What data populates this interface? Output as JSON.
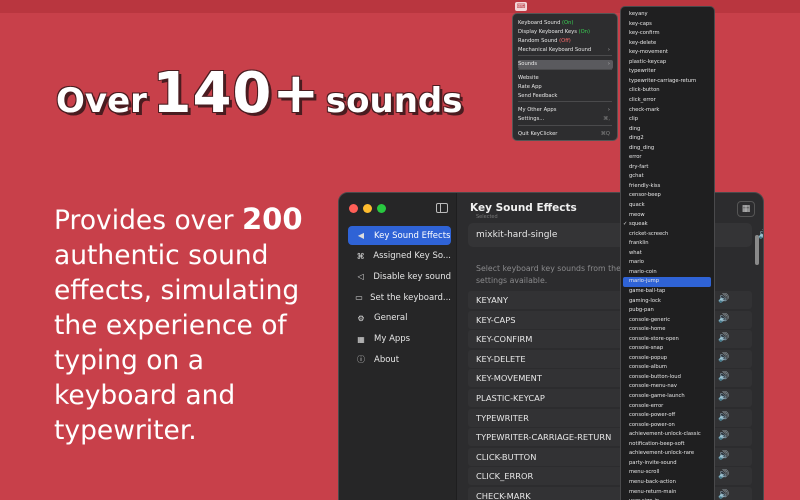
{
  "headline": {
    "prefix": "Over",
    "number": "140+",
    "suffix": "sounds"
  },
  "blurb": {
    "lines": [
      {
        "text": "Provides over ",
        "num": "200"
      },
      {
        "text": "authentic sound"
      },
      {
        "text": "effects, simulating"
      },
      {
        "text": "the experience of"
      },
      {
        "text": "typing on a"
      },
      {
        "text": "keyboard and"
      },
      {
        "text": "typewriter."
      }
    ]
  },
  "menubar": {
    "app_icon": "keyclicker-icon"
  },
  "menu": {
    "items": [
      {
        "label": "Keyboard Sound",
        "state": "(On)",
        "state_kind": "on",
        "icon": "speaker-icon"
      },
      {
        "label": "Display Keyboard Keys",
        "state": "(On)",
        "state_kind": "on",
        "icon": "display-icon"
      },
      {
        "label": "Random Sound",
        "state": "(Off)",
        "state_kind": "off",
        "icon": "shuffle-icon"
      },
      {
        "label": "Mechanical Keyboard Sound",
        "state": "",
        "arrow": "›",
        "icon": "keyboard-icon"
      },
      {
        "label": "Sounds",
        "state": "",
        "arrow": "›",
        "icon": "speaker-icon",
        "highlighted": true
      },
      {
        "label": "Website"
      },
      {
        "label": "Rate App"
      },
      {
        "label": "Send Feedback"
      },
      {
        "label": "My Other Apps",
        "arrow": "›"
      },
      {
        "label": "Settings...",
        "shortcut": "⌘,"
      },
      {
        "label": "Quit KeyClicker",
        "shortcut": "⌘Q"
      }
    ]
  },
  "sounds": {
    "items": [
      "keyany",
      "key-caps",
      "key-confirm",
      "key-delete",
      "key-movement",
      "plastic-keycap",
      "typewriter",
      "typewriter-carriage-return",
      "click-button",
      "click_error",
      "check-mark",
      "clip",
      "ding",
      "ding2",
      "ding_ding",
      "error",
      "dry-fart",
      "gchat",
      "friendly-kiss",
      "censor-beep",
      "quack",
      "meow",
      "squeak",
      "cricket-screech",
      "franklin",
      "what",
      "mario",
      "mario-coin",
      "mario-jump",
      "game-ball-tap",
      "gaming-lock",
      "pubg-pan",
      "console-generic",
      "console-home",
      "console-store-open",
      "console-snap",
      "console-popup",
      "console-album",
      "console-button-loud",
      "console-menu-nav",
      "console-game-launch",
      "console-error",
      "console-power-off",
      "console-power-on",
      "achievement-unlock-classic",
      "notification-beep-soft",
      "achievement-unlock-rare",
      "party-invite-sound",
      "menu-scroll",
      "menu-back-action",
      "menu-return-main",
      "user-sign-in"
    ],
    "checked": "squeak",
    "selected": "mario-jump",
    "check_glyph": "✓"
  },
  "window": {
    "sidebar": [
      {
        "label": "Key Sound Effects",
        "icon": "speaker-icon",
        "glyph": "◀",
        "active": true
      },
      {
        "label": "Assigned Key So...",
        "icon": "command-icon",
        "glyph": "⌘"
      },
      {
        "label": "Disable key sound",
        "icon": "speaker-mute-icon",
        "glyph": "◁"
      },
      {
        "label": "Set the keyboard...",
        "icon": "keyboard-icon",
        "glyph": "▭"
      },
      {
        "label": "General",
        "icon": "gear-icon",
        "glyph": "⚙"
      },
      {
        "label": "My Apps",
        "icon": "grid-icon",
        "glyph": "▦"
      },
      {
        "label": "About",
        "icon": "info-icon",
        "glyph": "ⓘ"
      }
    ],
    "title": "Key Sound Effects",
    "subtitle": "Selected",
    "selected_sound": "mixkit-hard-single",
    "description": "Select keyboard key sounds from the sound settings available.",
    "keys": [
      "KEYANY",
      "KEY-CAPS",
      "KEY-CONFIRM",
      "KEY-DELETE",
      "KEY-MOVEMENT",
      "PLASTIC-KEYCAP",
      "TYPEWRITER",
      "TYPEWRITER-CARRIAGE-RETURN",
      "CLICK-BUTTON",
      "CLICK_ERROR",
      "CHECK-MARK"
    ],
    "volume_glyph": "🔊"
  }
}
